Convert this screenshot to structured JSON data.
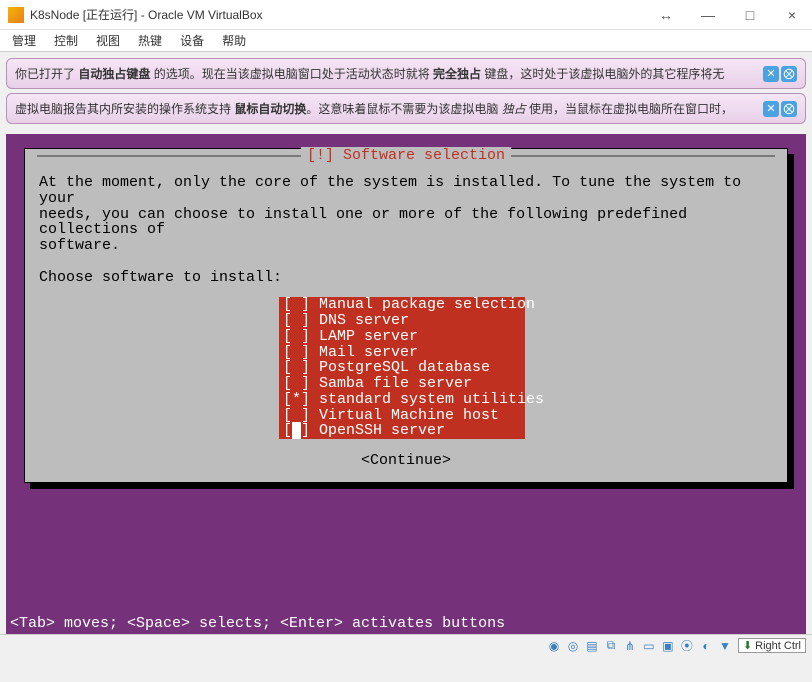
{
  "window": {
    "title": "K8sNode [正在运行] - Oracle VM VirtualBox",
    "minimize": "—",
    "maximize": "□",
    "close": "×",
    "move": "↔"
  },
  "menu": {
    "manage": "管理",
    "control": "控制",
    "view": "视图",
    "hotkeys": "热键",
    "devices": "设备",
    "help": "帮助"
  },
  "notif1": {
    "pre": "你已打开了 ",
    "bold1": "自动独占键盘",
    "mid": " 的选项。现在当该虚拟电脑窗口处于活动状态时就将 ",
    "bold2": "完全独占",
    "post": " 键盘，这时处于该虚拟电脑外的其它程序将无"
  },
  "notif2": {
    "pre": "虚拟电脑报告其内所安装的操作系统支持 ",
    "bold1": "鼠标自动切换",
    "mid": "。这意味着鼠标不需要为该虚拟电脑 ",
    "italic": "独占",
    "post": " 使用，当鼠标在虚拟电脑所在窗口时，"
  },
  "installer": {
    "title": "[!] Software selection",
    "para": "At the moment, only the core of the system is installed. To tune the system to your\nneeds, you can choose to install one or more of the following predefined collections of\nsoftware.",
    "choose": "Choose software to install:",
    "items": [
      {
        "mark": " ",
        "label": "Manual package selection"
      },
      {
        "mark": " ",
        "label": "DNS server"
      },
      {
        "mark": " ",
        "label": "LAMP server"
      },
      {
        "mark": " ",
        "label": "Mail server"
      },
      {
        "mark": " ",
        "label": "PostgreSQL database"
      },
      {
        "mark": " ",
        "label": "Samba file server"
      },
      {
        "mark": "*",
        "label": "standard system utilities"
      },
      {
        "mark": " ",
        "label": "Virtual Machine host"
      },
      {
        "mark": " ",
        "label": "OpenSSH server",
        "cursor": true
      }
    ],
    "continue": "<Continue>",
    "helpbar": "<Tab> moves; <Space> selects; <Enter> activates buttons"
  },
  "status": {
    "rightctrl": "Right Ctrl"
  }
}
